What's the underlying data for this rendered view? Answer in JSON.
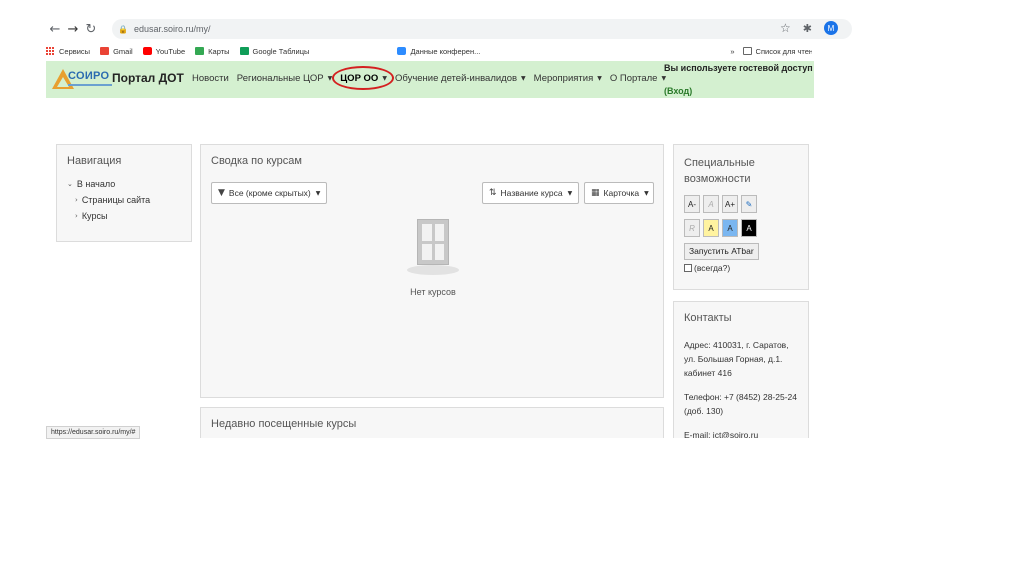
{
  "browser": {
    "url": "edusar.soiro.ru/my/",
    "profile_initial": "M",
    "bookmarks": [
      "Сервисы",
      "Gmail",
      "YouTube",
      "Карты",
      "Google Таблицы",
      "Данные конферен..."
    ],
    "bookmarks_overflow": "»",
    "reading_list": "Список для чтения"
  },
  "site": {
    "logo_text": "СОИРО",
    "portal_title": "Портал ДОТ",
    "menu": [
      "Новости",
      "Региональные ЦОР",
      "ЦОР ОО",
      "Обучение детей-инвалидов",
      "Мероприятия",
      "О Портале"
    ],
    "guest_text": "Вы используете гостевой доступ",
    "login_text": "(Вход)"
  },
  "navigation": {
    "title": "Навигация",
    "items": [
      "В начало",
      "Страницы сайта",
      "Курсы"
    ]
  },
  "courses": {
    "title": "Сводка по курсам",
    "filter_label": "Все (кроме скрытых)",
    "sort_label": "Название курса",
    "view_label": "Карточка",
    "empty_text": "Нет курсов"
  },
  "recent": {
    "title": "Недавно посещенные курсы"
  },
  "accessibility": {
    "title": "Специальные возможности",
    "row1": [
      "A-",
      "A",
      "A+"
    ],
    "row2": [
      "R",
      "A",
      "A",
      "A"
    ],
    "atbar_button": "Запустить ATbar",
    "always_label": "(всегда?)"
  },
  "contacts": {
    "title": "Контакты",
    "address": "Адрес: 410031, г. Саратов, ул. Большая Горная, д.1. кабинет 416",
    "phone": "Телефон: +7 (8452) 28-25-24 (доб. 130)",
    "email": "E-mail: ict@soiro.ru"
  },
  "statusbar": {
    "url": "https://edusar.soiro.ru/my/#"
  },
  "colors": {
    "header_bg": "#d4f0d0",
    "highlight_circle": "#d42020",
    "login_green": "#2a7a2a"
  }
}
